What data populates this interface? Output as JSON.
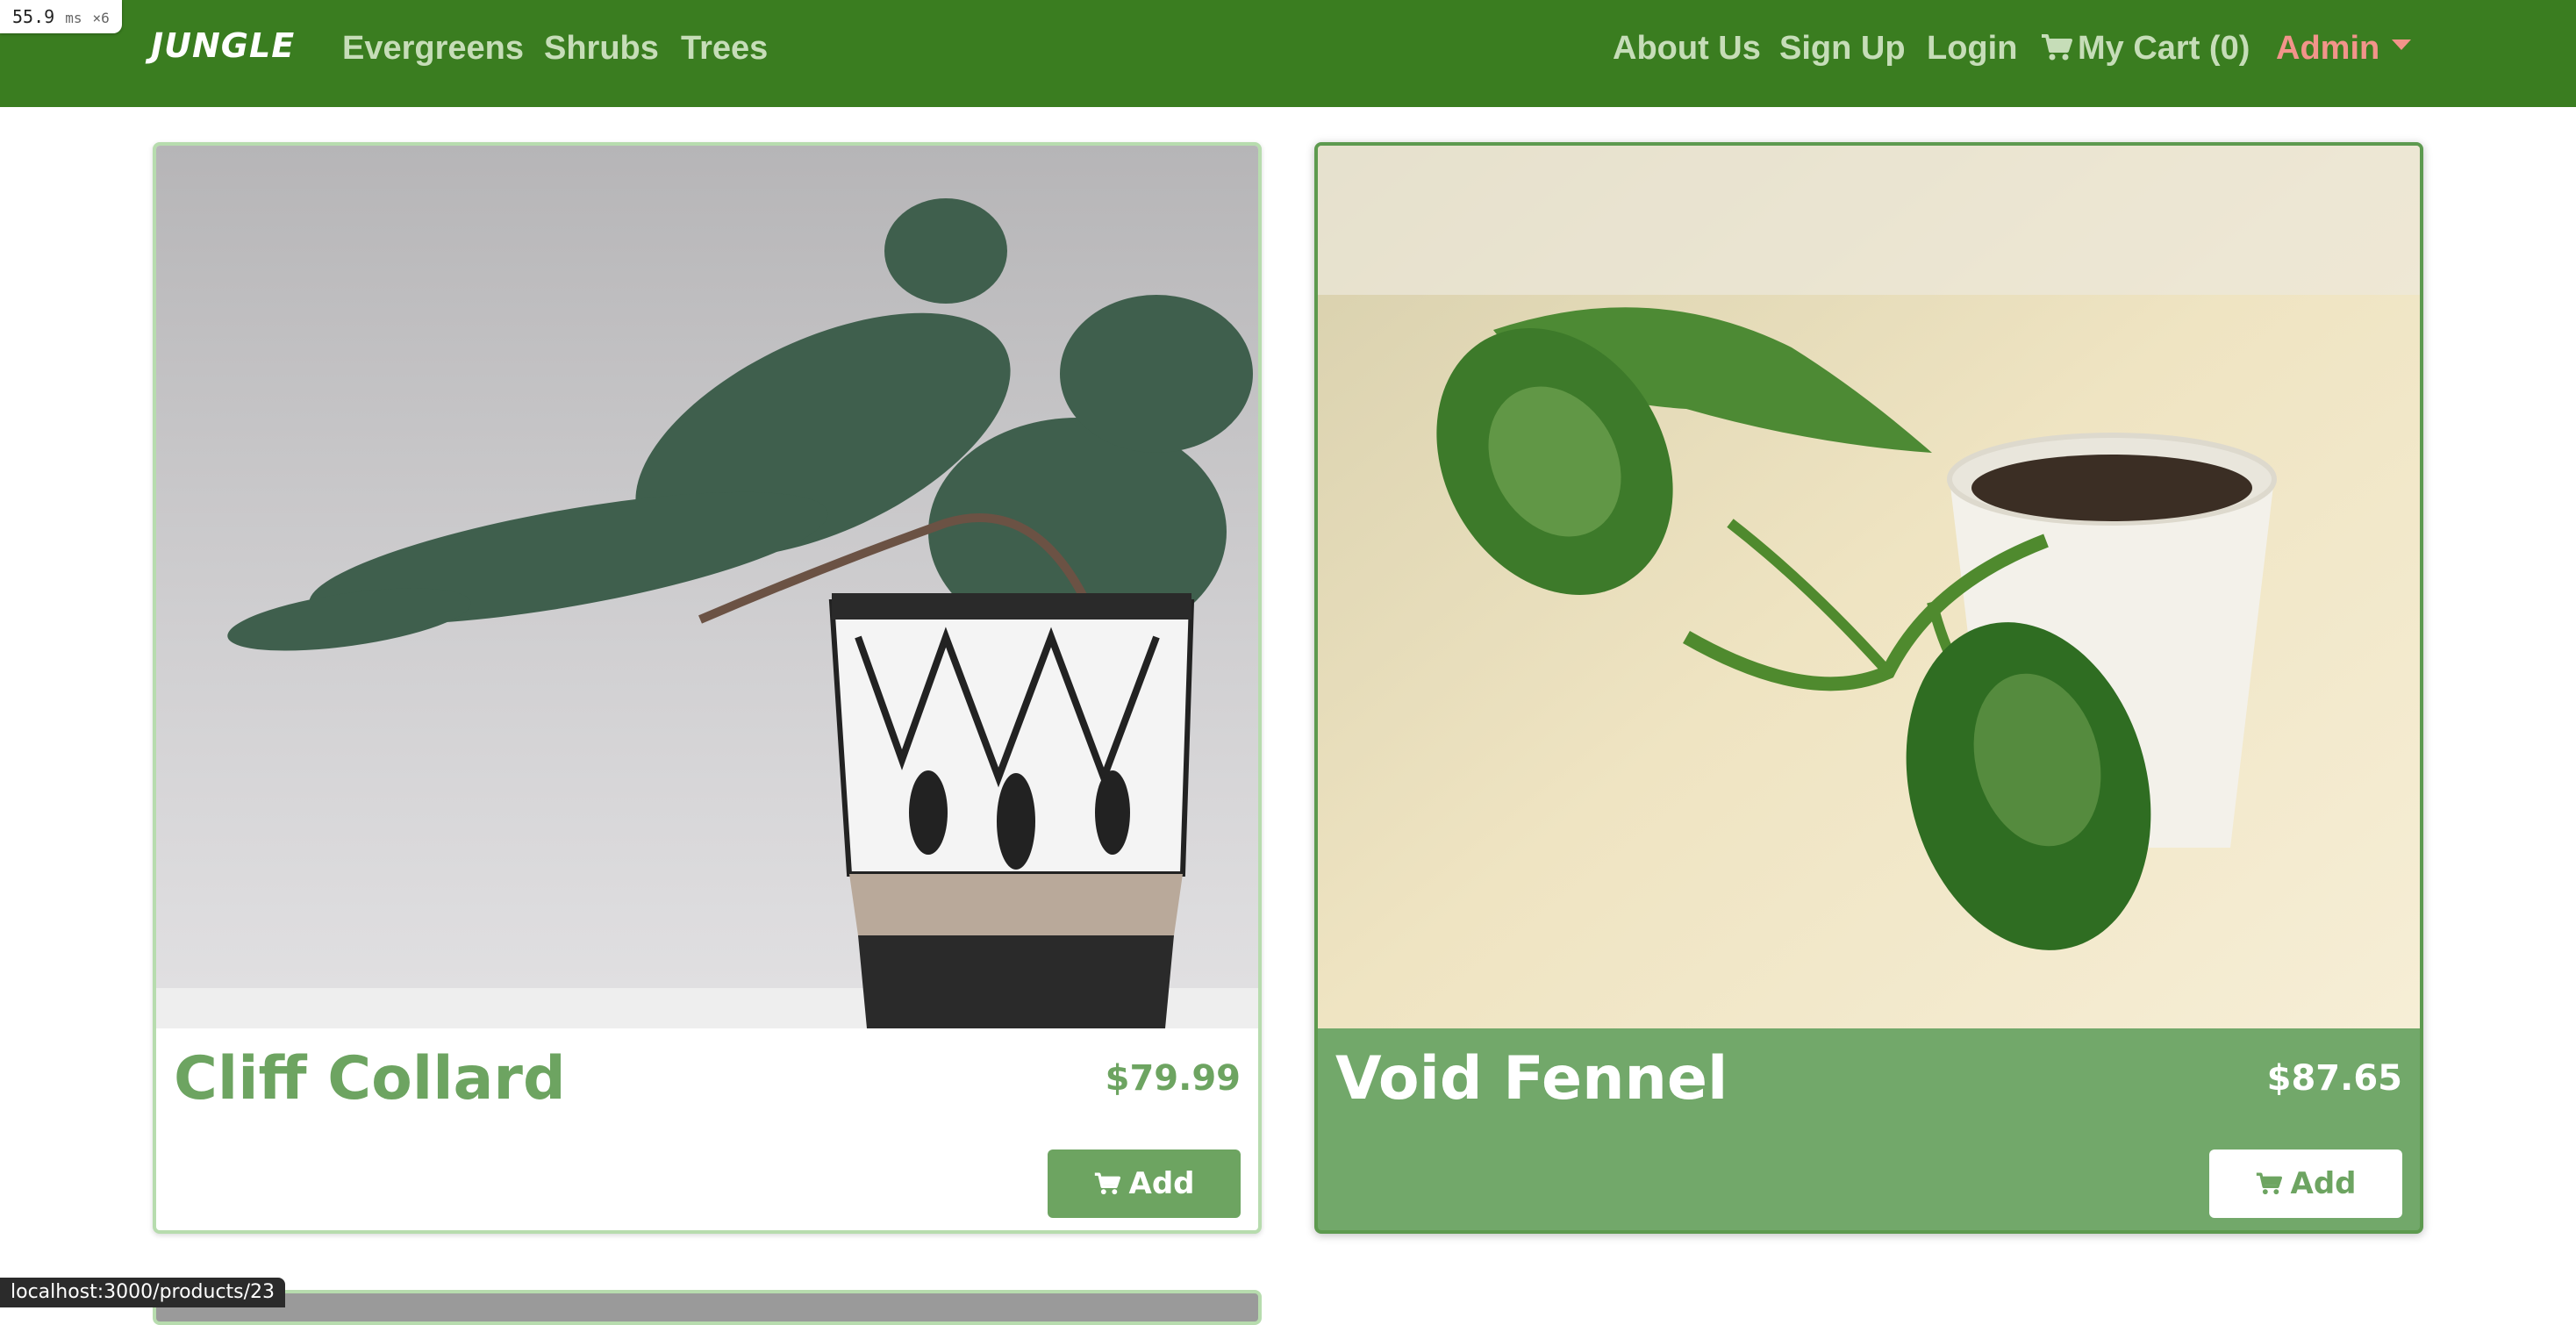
{
  "navbar": {
    "brand": "JUNGLE",
    "left_links": [
      "Evergreens",
      "Shrubs",
      "Trees"
    ],
    "right_links": {
      "about": "About Us",
      "signup": "Sign Up",
      "login": "Login",
      "cart": "My Cart (0)",
      "admin": "Admin"
    }
  },
  "products": [
    {
      "name": "Cliff Collard",
      "price": "$79.99",
      "add_label": "Add",
      "image": "bonsai juniper in patterned pot"
    },
    {
      "name": "Void Fennel",
      "price": "$87.65",
      "add_label": "Add",
      "image": "pothos cutting in white pot"
    }
  ],
  "overlay": {
    "perf_value": "55.9",
    "perf_unit": "ms",
    "perf_mult": "×6",
    "status_url": "localhost:3000/products/23"
  },
  "colors": {
    "navbar_bg": "#3a7d20",
    "nav_link": "#c6ddb8",
    "admin_link": "#f2948a",
    "accent_green": "#6da461",
    "card_highlight_bg": "#72a86a"
  }
}
